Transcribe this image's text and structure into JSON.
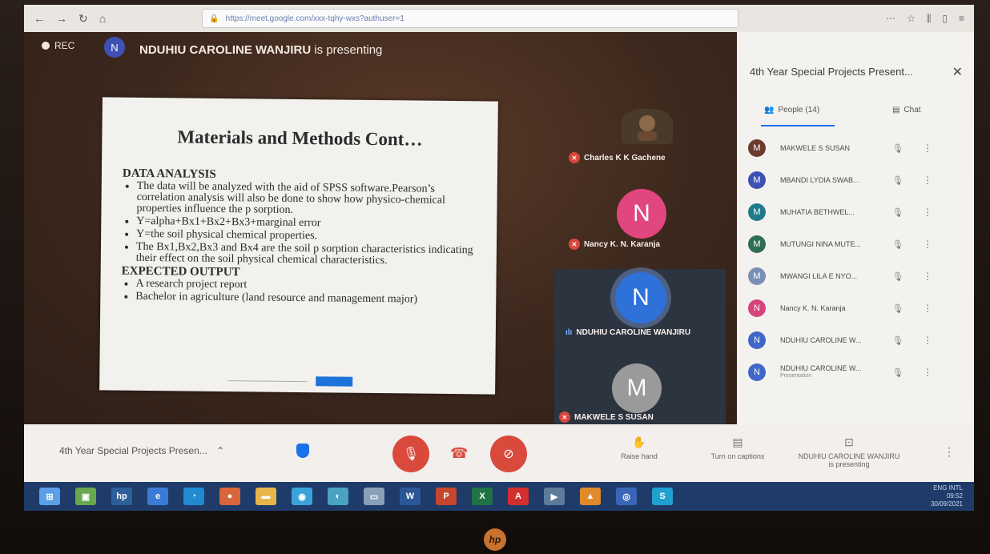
{
  "browser": {
    "url": "https://meet.google.com/xxx-tqhy-wxs?authuser=1"
  },
  "stage": {
    "rec_label": "REC",
    "presenter_initial": "N",
    "presenter_name": "NDUHIU CAROLINE WANJIRU",
    "presenting_suffix": "is presenting"
  },
  "slide": {
    "title": "Materials and Methods Cont…",
    "section1": "DATA ANALYSIS",
    "bullets1": [
      "The data will be analyzed with the aid of SPSS software.Pearson’s correlation analysis will also be done to show how physico-chemical properties influence the p sorption.",
      "Y=alpha+Bx1+Bx2+Bx3+marginal error",
      "Y=the soil physical chemical properties.",
      "The Bx1,Bx2,Bx3 and Bx4 are the soil p sorption characteristics indicating their effect on the soil physical chemical characteristics."
    ],
    "section2": "EXPECTED OUTPUT",
    "bullets2": [
      "A research project report",
      "Bachelor in agriculture (land resource and management major)"
    ]
  },
  "tiles": [
    {
      "name": "Charles K K Gachene",
      "initial": ""
    },
    {
      "name": "Nancy K. N. Karanja",
      "initial": "N"
    },
    {
      "name": "NDUHIU CAROLINE WANJIRU",
      "initial": "N"
    },
    {
      "name": "MAKWELE S SUSAN",
      "initial": "M"
    }
  ],
  "panel": {
    "title": "4th Year Special Projects Present...",
    "people_tab": "People (14)",
    "chat_tab": "Chat",
    "people": [
      {
        "initial": "M",
        "name": "MAKWELE S SUSAN",
        "sub": "",
        "color": "#6d3b2e"
      },
      {
        "initial": "M",
        "name": "MBANDI LYDIA SWAB...",
        "sub": "",
        "color": "#3f51b5"
      },
      {
        "initial": "M",
        "name": "MUHATIA BETHWEL...",
        "sub": "",
        "color": "#1f7a8c"
      },
      {
        "initial": "M",
        "name": "MUTUNGI NINA MUTE...",
        "sub": "",
        "color": "#2e6e55"
      },
      {
        "initial": "M",
        "name": "MWANGI LILA E NYO...",
        "sub": "",
        "color": "#7a8fb5"
      },
      {
        "initial": "N",
        "name": "Nancy K. N. Karanja",
        "sub": "",
        "color": "#d6457a"
      },
      {
        "initial": "N",
        "name": "NDUHIU CAROLINE W...",
        "sub": "",
        "color": "#3f67c8"
      },
      {
        "initial": "N",
        "name": "NDUHIU CAROLINE W...",
        "sub": "Presentation",
        "color": "#3f67c8"
      }
    ]
  },
  "controls": {
    "meeting_name": "4th Year Special Projects Presen...",
    "raise_hand": "Raise hand",
    "captions": "Turn on captions",
    "presenting_line1": "NDUHIU CAROLINE WANJIRU",
    "presenting_line2": "is presenting"
  },
  "taskbar": {
    "time": "09:52",
    "date": "30/09/2021",
    "lang": "ENG INTL"
  },
  "device": {
    "logo": "hp"
  }
}
